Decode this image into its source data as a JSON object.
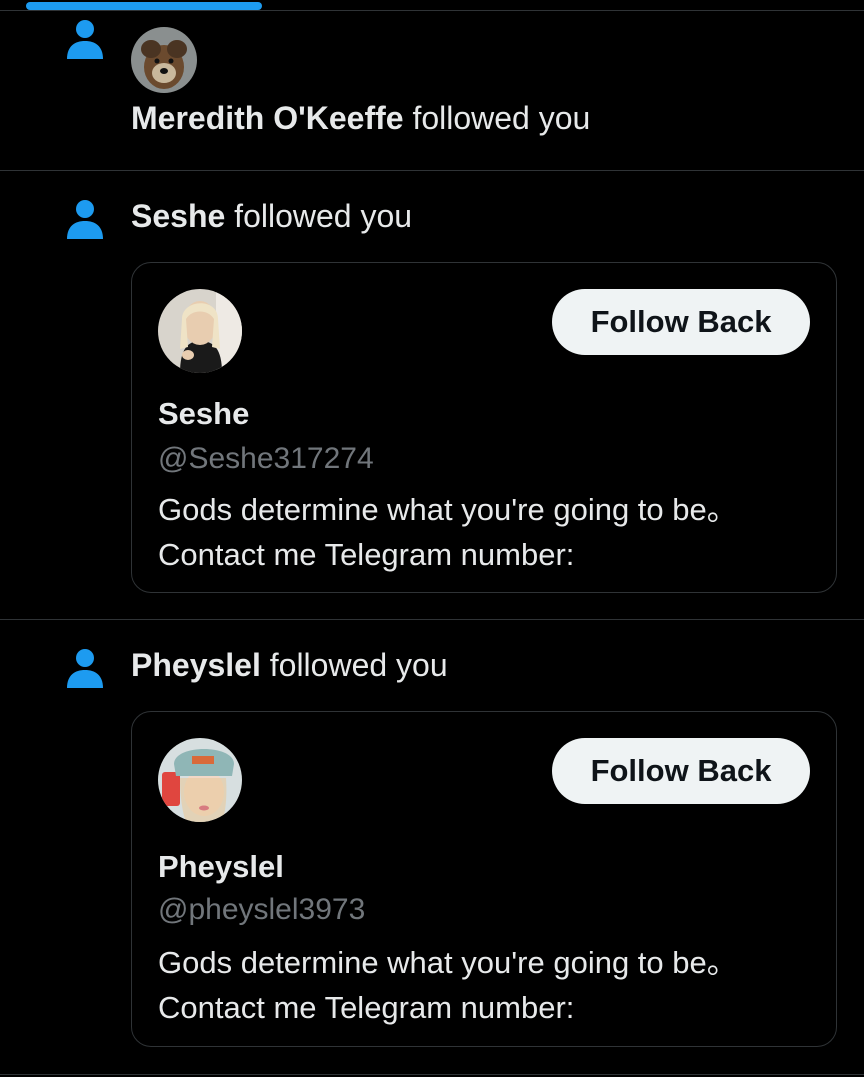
{
  "colors": {
    "background": "#000000",
    "accent": "#1d9bf0",
    "divider": "#2f3336",
    "text_primary": "#e7e9ea",
    "text_secondary": "#71767b",
    "button_bg": "#eff3f4",
    "button_text": "#0f1419"
  },
  "notifications": [
    {
      "icon": "person-icon",
      "user_name": "Meredith O'Keeffe",
      "action_text": " followed you"
    },
    {
      "icon": "person-icon",
      "user_name": "Seshe",
      "action_text": " followed you",
      "card": {
        "name": "Seshe",
        "handle": "@Seshe317274",
        "bio": "Gods determine what you're going to be。\nContact me Telegram number:",
        "button_label": "Follow Back"
      }
    },
    {
      "icon": "person-icon",
      "user_name": "Pheyslel",
      "action_text": " followed you",
      "card": {
        "name": "Pheyslel",
        "handle": "@pheyslel3973",
        "bio": "Gods determine what you're going to be。\nContact me Telegram number:",
        "button_label": "Follow Back"
      }
    }
  ]
}
